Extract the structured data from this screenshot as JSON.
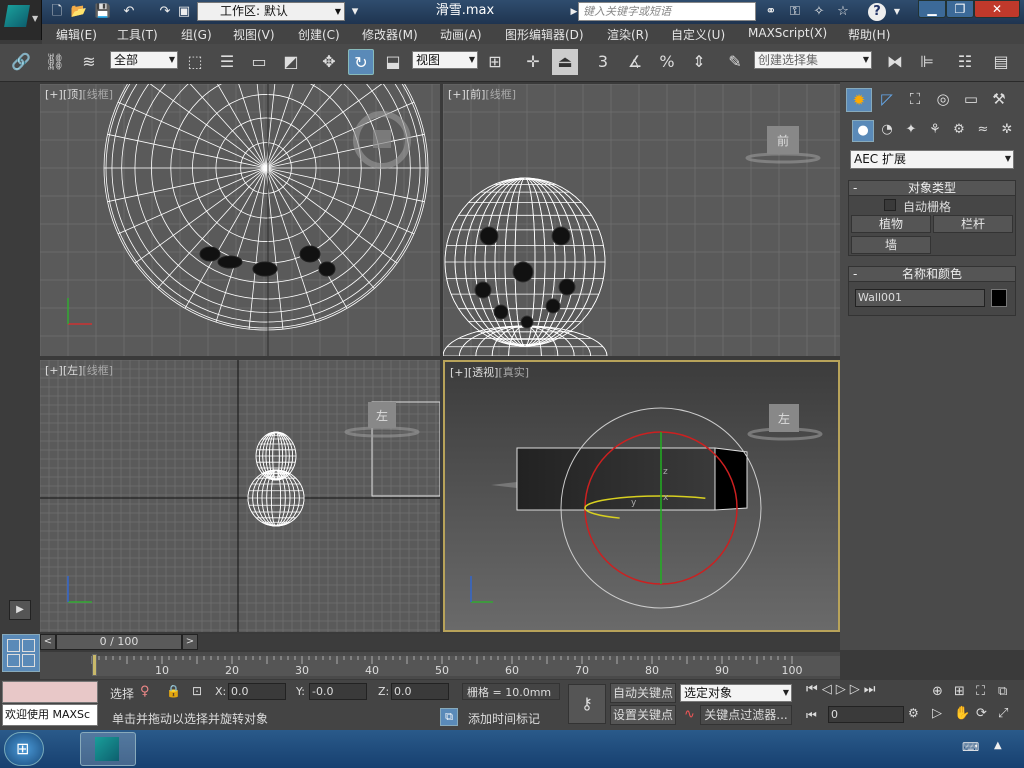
{
  "title": {
    "workspace_label": "工作区: 默认",
    "filename": "滑雪.max",
    "search_placeholder": "键入关键字或短语"
  },
  "menus": [
    "编辑(E)",
    "工具(T)",
    "组(G)",
    "视图(V)",
    "创建(C)",
    "修改器(M)",
    "动画(A)",
    "图形编辑器(D)",
    "渲染(R)",
    "自定义(U)",
    "MAXScript(X)",
    "帮助(H)"
  ],
  "toolbar": {
    "filter_selected": "全部",
    "ref_coord_selected": "视图",
    "named_selection_placeholder": "创建选择集",
    "snap_angle_label": "3",
    "percent_snap_label": "%"
  },
  "viewports": {
    "top": {
      "bracket": "[+]",
      "name": "[顶]",
      "mode": "[线框]"
    },
    "front": {
      "bracket": "[+]",
      "name": "[前]",
      "mode": "[线框]",
      "cube_label": "前"
    },
    "left": {
      "bracket": "[+]",
      "name": "[左]",
      "mode": "[线框]",
      "cube_label": "左"
    },
    "perspective": {
      "bracket": "[+]",
      "name": "[透视]",
      "mode": "[真实]",
      "cube_label": "左"
    }
  },
  "command_panel": {
    "category_selected": "AEC 扩展",
    "object_type_header": "对象类型",
    "autogrid_label": "自动栅格",
    "buttons": [
      "植物",
      "栏杆",
      "墙"
    ],
    "name_color_header": "名称和颜色",
    "object_name": "Wall001",
    "object_color": "#000000"
  },
  "timeline": {
    "frame_display": "0 / 100",
    "ticks": [
      "10",
      "20",
      "30",
      "40",
      "50",
      "60",
      "70",
      "80",
      "90",
      "100"
    ]
  },
  "status": {
    "maxscript_label": "欢迎使用 MAXSc",
    "selection_label": "选择",
    "x_label": "X:",
    "x_value": "0.0",
    "y_label": "Y:",
    "y_value": "-0.0",
    "z_label": "Z:",
    "z_value": "0.0",
    "grid_label": "栅格 = 10.0mm",
    "prompt": "单击并拖动以选择并旋转对象",
    "add_time_tag": "添加时间标记",
    "auto_key": "自动关键点",
    "set_key": "设置关键点",
    "key_target_selected": "选定对象",
    "key_filters": "关键点过滤器...",
    "current_frame": "0"
  },
  "colors": {
    "accent_active": "#5a8ab8",
    "persp_border": "#b8a35a",
    "gizmo_red": "#cc2020",
    "gizmo_green": "#20b020",
    "gizmo_yellow": "#d8d020"
  }
}
